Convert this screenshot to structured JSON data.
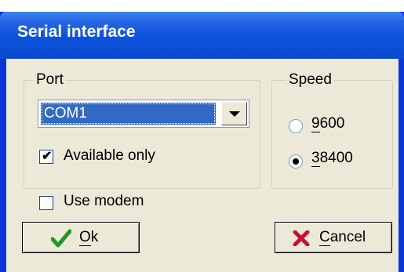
{
  "dialog": {
    "title": "Serial interface"
  },
  "port": {
    "group_label": "Port",
    "selected": "COM1",
    "available_only_label": "Available only",
    "available_only_checked": true
  },
  "speed": {
    "group_label": "Speed",
    "options": [
      {
        "hotkey": "9",
        "rest": "600",
        "selected": false
      },
      {
        "hotkey": "3",
        "rest": "8400",
        "selected": true
      }
    ]
  },
  "modem": {
    "label": "Use modem",
    "checked": false
  },
  "buttons": {
    "ok": {
      "hotkey": "O",
      "rest": "k",
      "icon": "green-checkmark-icon"
    },
    "cancel": {
      "hotkey": "C",
      "rest": "ancel",
      "icon": "red-x-icon"
    }
  },
  "colors": {
    "title_bar": "#0c52dc",
    "selection": "#316ac5",
    "dialog_bg": "#ece9d8"
  }
}
